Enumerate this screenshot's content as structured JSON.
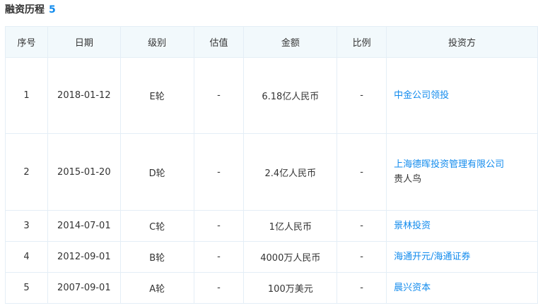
{
  "section": {
    "title": "融资历程",
    "count": "5"
  },
  "columns": [
    "序号",
    "日期",
    "级别",
    "估值",
    "金额",
    "比例",
    "投资方"
  ],
  "rows": [
    {
      "no": "1",
      "date": "2018-01-12",
      "round": "E轮",
      "valuation": "-",
      "amount": "6.18亿人民币",
      "ratio": "-",
      "investors": [
        "中金公司领投"
      ],
      "plain": ""
    },
    {
      "no": "2",
      "date": "2015-01-20",
      "round": "D轮",
      "valuation": "-",
      "amount": "2.4亿人民币",
      "ratio": "-",
      "investors": [
        "上海德晖投资管理有限公司"
      ],
      "plain": "贵人鸟"
    },
    {
      "no": "3",
      "date": "2014-07-01",
      "round": "C轮",
      "valuation": "-",
      "amount": "1亿人民币",
      "ratio": "-",
      "investors": [
        "景林投资"
      ],
      "plain": ""
    },
    {
      "no": "4",
      "date": "2012-09-01",
      "round": "B轮",
      "valuation": "-",
      "amount": "4000万人民币",
      "ratio": "-",
      "investors": [
        "海通开元/海通证券"
      ],
      "plain": ""
    },
    {
      "no": "5",
      "date": "2007-09-01",
      "round": "A轮",
      "valuation": "-",
      "amount": "100万美元",
      "ratio": "-",
      "investors": [
        "晨兴资本"
      ],
      "plain": ""
    }
  ],
  "colors": {
    "link": "#128bed",
    "header_bg": "#f2f9fc",
    "border": "#e4eef6"
  }
}
